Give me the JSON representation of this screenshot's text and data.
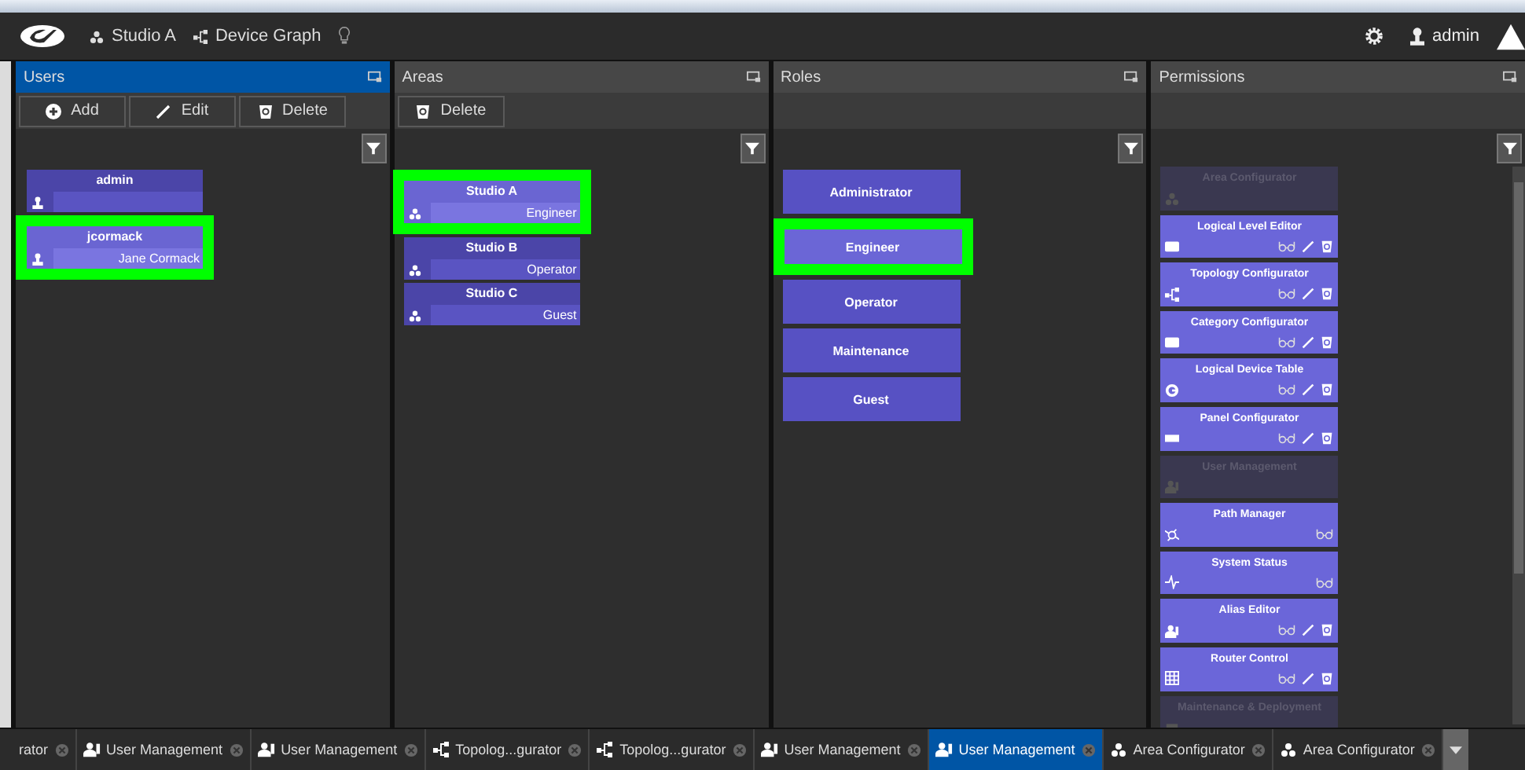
{
  "topbar": {
    "items": [
      {
        "kind": "area",
        "label": "Studio A"
      },
      {
        "kind": "graph",
        "label": "Device Graph"
      }
    ],
    "user": "admin"
  },
  "panels": [
    {
      "kind": "users",
      "title": "Users",
      "active": true,
      "buttons": [
        {
          "kind": "add",
          "label": "Add"
        },
        {
          "kind": "edit",
          "label": "Edit"
        },
        {
          "kind": "delete",
          "label": "Delete"
        }
      ],
      "items": [
        {
          "name": "admin",
          "selected": false
        },
        {
          "name": "jcormack",
          "detail": "Jane Cormack",
          "selected": true
        }
      ]
    },
    {
      "kind": "areas",
      "title": "Areas",
      "active": false,
      "buttons": [
        {
          "kind": "delete",
          "label": "Delete"
        }
      ],
      "items": [
        {
          "name": "Studio A",
          "detail": "Engineer",
          "selected": true
        },
        {
          "name": "Studio B",
          "detail": "Operator",
          "selected": false
        },
        {
          "name": "Studio C",
          "detail": "Guest",
          "selected": false
        }
      ]
    },
    {
      "kind": "roles",
      "title": "Roles",
      "active": false,
      "items": [
        {
          "name": "Administrator",
          "selected": false
        },
        {
          "name": "Engineer",
          "selected": true
        },
        {
          "name": "Operator",
          "selected": false
        },
        {
          "name": "Maintenance",
          "selected": false
        },
        {
          "name": "Guest",
          "selected": false
        }
      ]
    },
    {
      "kind": "permissions",
      "title": "Permissions",
      "active": false,
      "items": [
        {
          "name": "Area Configurator",
          "enabled": false,
          "can_view": false,
          "can_edit": false,
          "can_delete": false
        },
        {
          "name": "Logical Level Editor",
          "enabled": true,
          "can_view": true,
          "can_edit": true,
          "can_delete": true
        },
        {
          "name": "Topology Configurator",
          "enabled": true,
          "can_view": true,
          "can_edit": true,
          "can_delete": true
        },
        {
          "name": "Category Configurator",
          "enabled": true,
          "can_view": true,
          "can_edit": true,
          "can_delete": true
        },
        {
          "name": "Logical Device Table",
          "enabled": true,
          "can_view": true,
          "can_edit": true,
          "can_delete": true
        },
        {
          "name": "Panel Configurator",
          "enabled": true,
          "can_view": true,
          "can_edit": true,
          "can_delete": true
        },
        {
          "name": "User Management",
          "enabled": false,
          "can_view": false,
          "can_edit": false,
          "can_delete": false
        },
        {
          "name": "Path Manager",
          "enabled": true,
          "can_view": true,
          "can_edit": false,
          "can_delete": false
        },
        {
          "name": "System Status",
          "enabled": true,
          "can_view": true,
          "can_edit": false,
          "can_delete": false
        },
        {
          "name": "Alias Editor",
          "enabled": true,
          "can_view": true,
          "can_edit": true,
          "can_delete": true
        },
        {
          "name": "Router Control",
          "enabled": true,
          "can_view": true,
          "can_edit": true,
          "can_delete": true
        },
        {
          "name": "Maintenance & Deployment",
          "enabled": false,
          "can_view": false,
          "can_edit": false,
          "can_delete": false
        }
      ]
    }
  ],
  "tabs": [
    {
      "label": "rator",
      "selected": false
    },
    {
      "label": "User Management",
      "selected": false
    },
    {
      "label": "User Management",
      "selected": false
    },
    {
      "label": "Topolog...gurator",
      "selected": false
    },
    {
      "label": "Topolog...gurator",
      "selected": false
    },
    {
      "label": "User Management",
      "selected": false
    },
    {
      "label": "User Management",
      "selected": true
    },
    {
      "label": "Area Configurator",
      "selected": false
    },
    {
      "label": "Area Configurator",
      "selected": false
    }
  ]
}
